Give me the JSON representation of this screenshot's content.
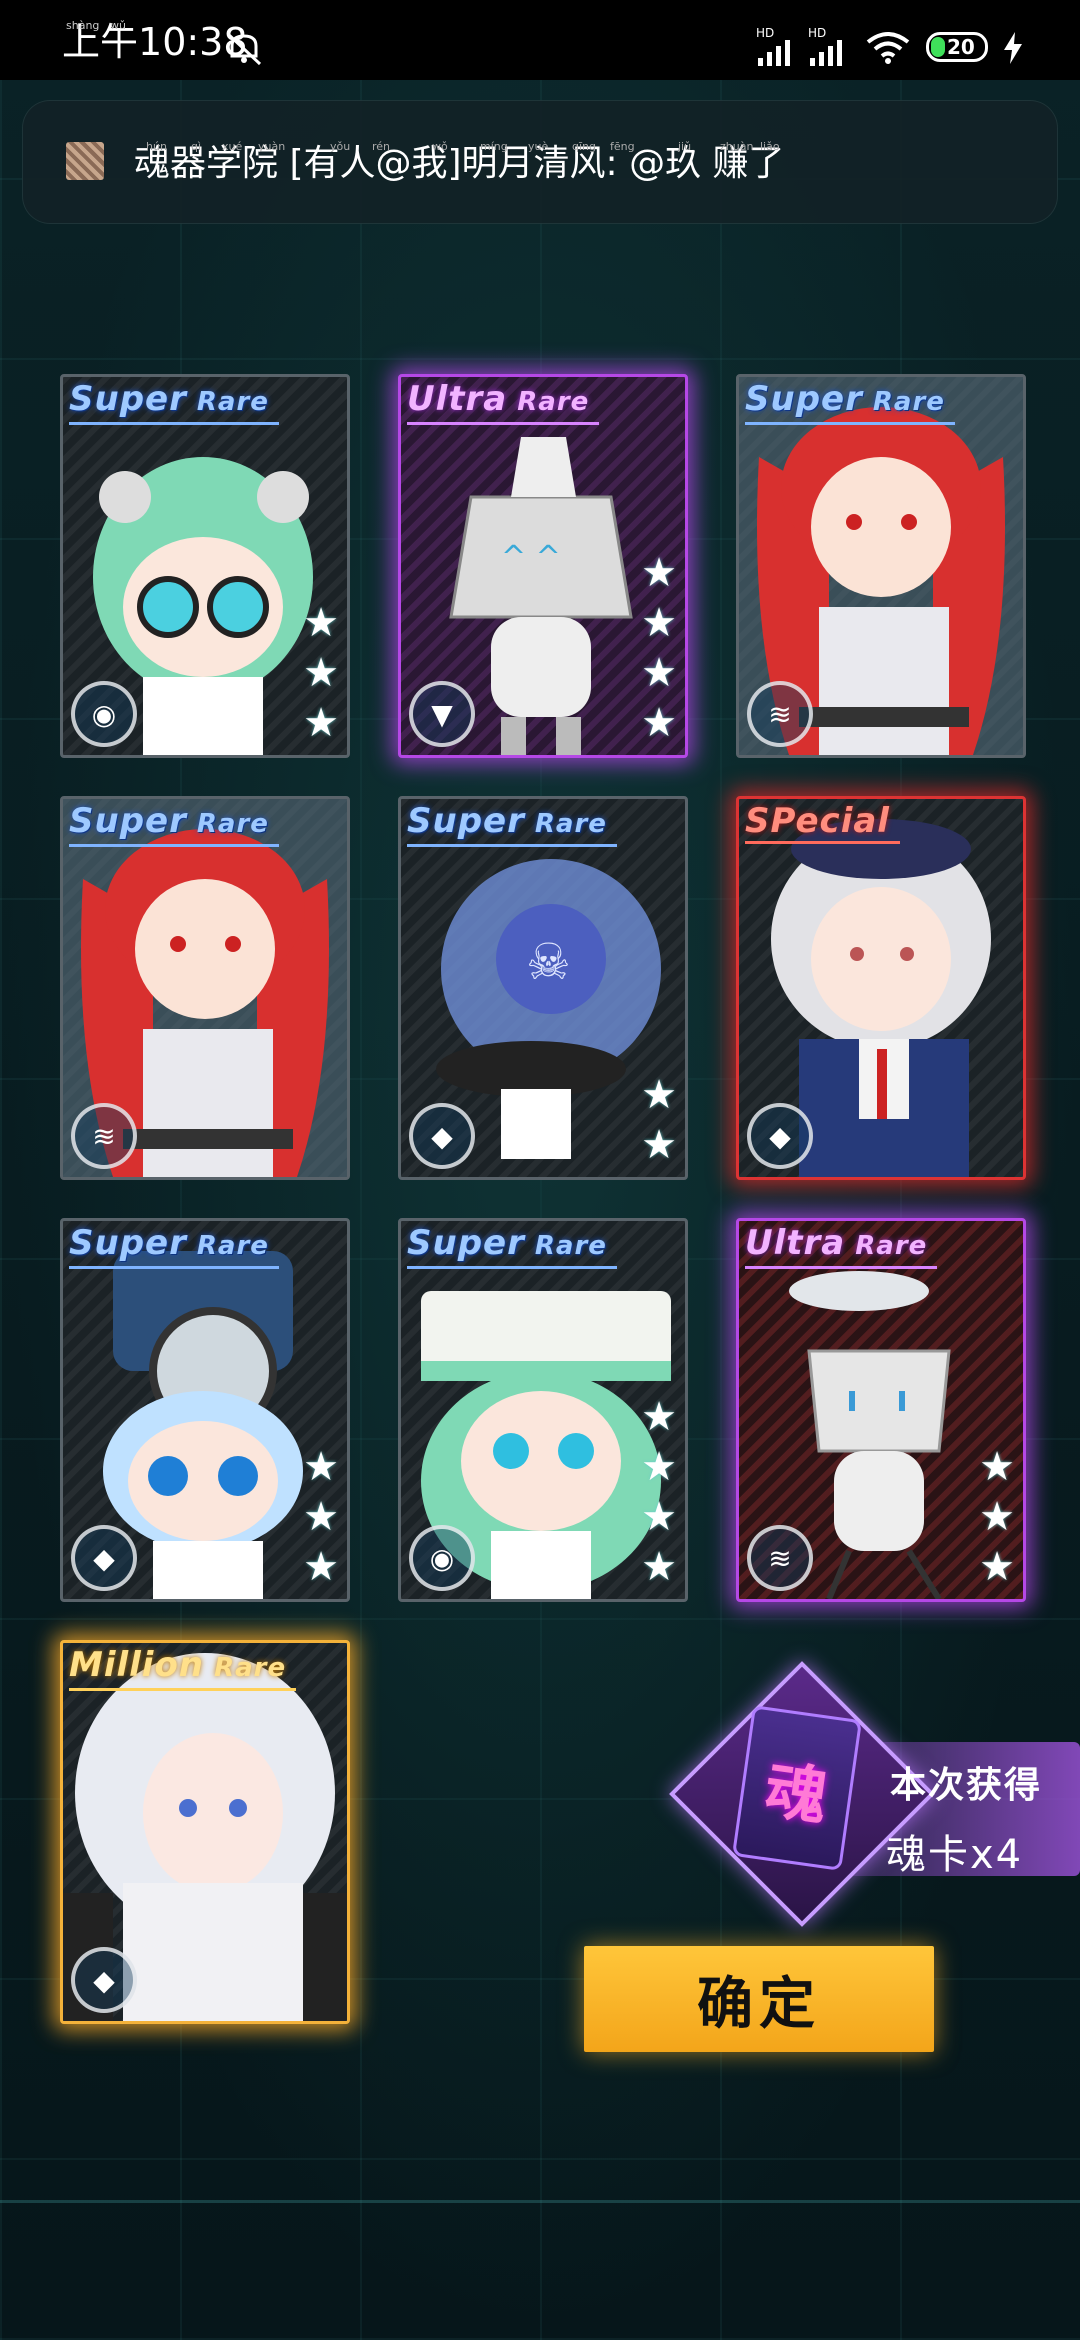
{
  "status_bar": {
    "time_prefix": "上午",
    "time": "10:38",
    "ruby_shang": "shàng",
    "ruby_wu": "wǔ",
    "signal_1": "HD",
    "signal_2": "HD",
    "battery": "20"
  },
  "notification": {
    "text": "魂器学院 [有人@我]明月清风: @玖 赚了",
    "pinyin": [
      "hún",
      "qì",
      "xué",
      "yuàn",
      "yǒu",
      "rén",
      "wǒ",
      "míng",
      "yuè",
      "qīng",
      "fēng",
      "jiǔ",
      "zhuàn",
      "liǎo"
    ]
  },
  "cards": [
    {
      "rarity_a": "Super",
      "rarity_b": "Rare",
      "tier": "super",
      "stars": 3,
      "badge": "wifi-icon",
      "char": "green-hair-goggles"
    },
    {
      "rarity_a": "Ultra",
      "rarity_b": "Rare",
      "tier": "ultra",
      "stars": 4,
      "badge": "triangle-icon",
      "char": "box-robot"
    },
    {
      "rarity_a": "Super",
      "rarity_b": "Rare",
      "tier": "super",
      "stars": 0,
      "badge": "stripes-icon",
      "char": "red-twintails"
    },
    {
      "rarity_a": "Super",
      "rarity_b": "Rare",
      "tier": "super",
      "stars": 0,
      "badge": "stripes-icon",
      "char": "red-twintails"
    },
    {
      "rarity_a": "Super",
      "rarity_b": "Rare",
      "tier": "super",
      "stars": 2,
      "badge": "drop-icon",
      "char": "skull-dome"
    },
    {
      "rarity_a": "SPecial",
      "rarity_b": "",
      "tier": "special",
      "stars": 0,
      "badge": "drop-icon",
      "char": "silver-officer"
    },
    {
      "rarity_a": "Super",
      "rarity_b": "Rare",
      "tier": "super",
      "stars": 3,
      "badge": "drop-icon",
      "char": "fan-helmet"
    },
    {
      "rarity_a": "Super",
      "rarity_b": "Rare",
      "tier": "super",
      "stars": 4,
      "badge": "wifi-icon",
      "char": "green-captain"
    },
    {
      "rarity_a": "Ultra",
      "rarity_b": "Rare",
      "tier": "ultra",
      "stars": 3,
      "badge": "stripes-icon",
      "char": "box-robot-2"
    },
    {
      "rarity_a": "Million",
      "rarity_b": "Rare",
      "tier": "million",
      "stars": 0,
      "badge": "drop-icon",
      "char": "white-hair"
    }
  ],
  "reward": {
    "label": "本次获得",
    "count": "魂卡x4",
    "soul_glyph": "魂"
  },
  "confirm_label": "确定"
}
